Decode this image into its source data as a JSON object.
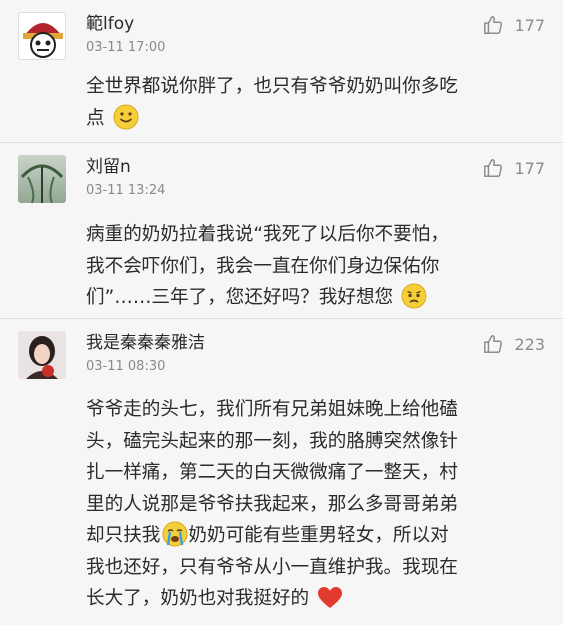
{
  "comments": [
    {
      "username": "範lfoy",
      "time": "03-11 17:00",
      "likes": "177",
      "lines": [
        "全世界都说你胖了，也只有爷爷奶奶叫你多吃",
        "点"
      ],
      "emoji": "smile-emoji"
    },
    {
      "username": "刘留n",
      "time": "03-11 13:24",
      "likes": "177",
      "lines": [
        "病重的奶奶拉着我说“我死了以后你不要怕，",
        "我不会吓你们，我会一直在你们身边保佑你",
        "们”……三年了，您还好吗？我好想您"
      ],
      "emoji": "sad-emoji"
    },
    {
      "username": "我是秦秦秦雅洁",
      "time": "03-11 08:30",
      "likes": "223",
      "lines": [
        "爷爷走的头七，我们所有兄弟姐妹晚上给他磕",
        "头，磕完头起来的那一刻，我的胳膊突然像针",
        "扎一样痛，第二天的白天微微痛了一整天，村",
        "里的人说那是爷爷扶我起来，那么多哥哥弟弟",
        "却只扶我",
        "奶奶可能有些重男轻女，所以对",
        "我也还好，只有爷爷从小一直维护我。我现在",
        "长大了，奶奶也对我挺好的"
      ],
      "emoji_inline": "crying-emoji",
      "emoji": "heart-emoji"
    }
  ]
}
